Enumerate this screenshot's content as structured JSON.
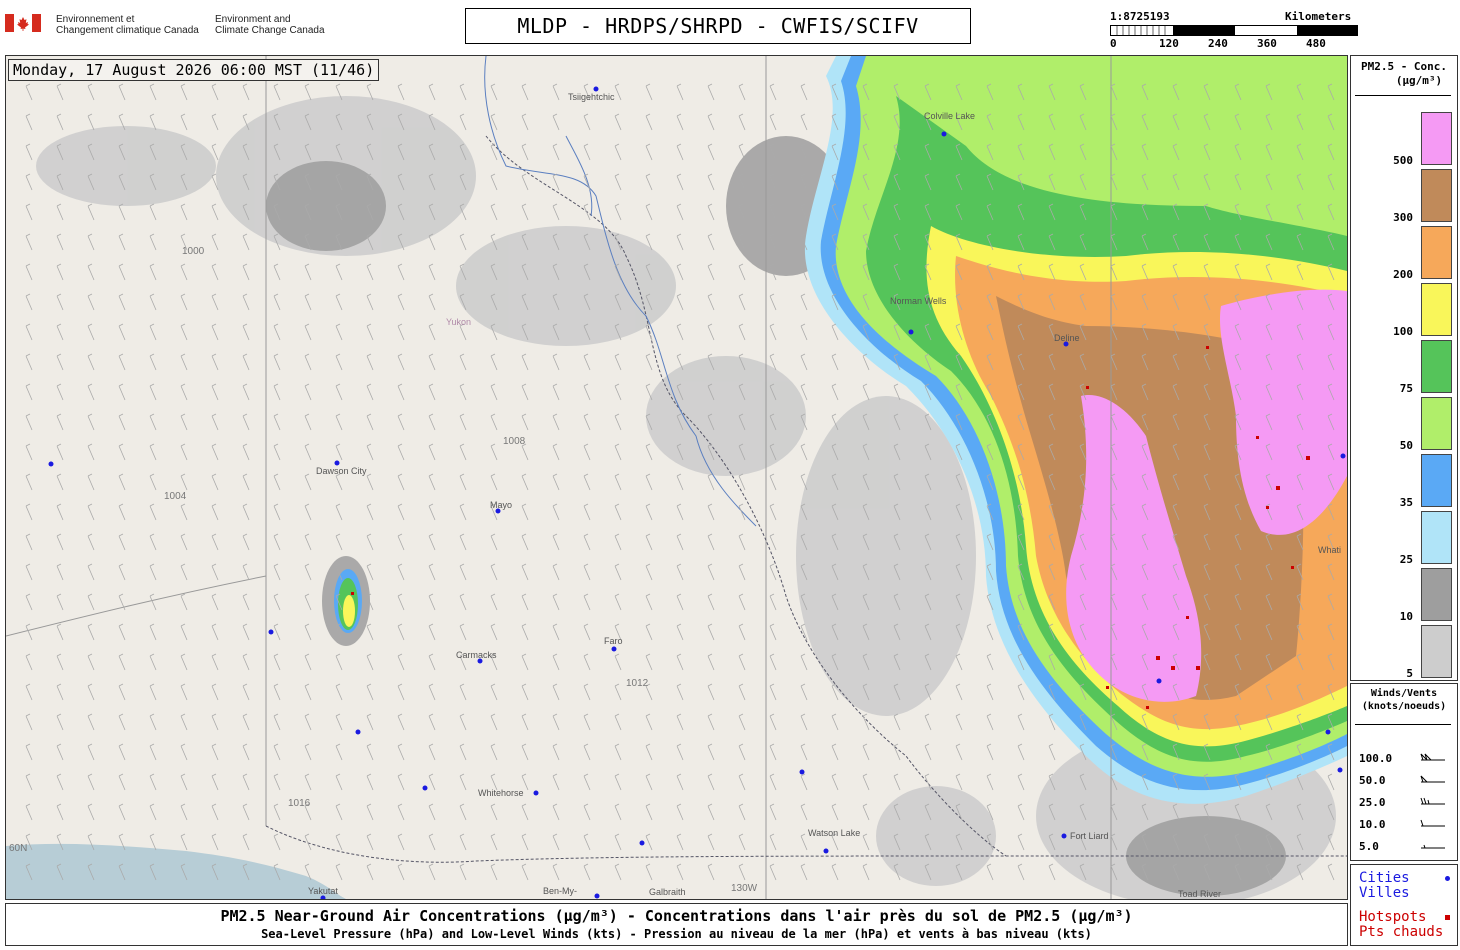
{
  "header": {
    "agency_fr_line1": "Environnement et",
    "agency_fr_line2": "Changement climatique Canada",
    "agency_en_line1": "Environment and",
    "agency_en_line2": "Climate Change Canada",
    "title": "MLDP - HRDPS/SHRPD - CWFIS/SCIFV"
  },
  "scale": {
    "ratio": "1:8725193",
    "unit": "Kilometers",
    "ticks": [
      "0",
      "120",
      "240",
      "360",
      "480"
    ]
  },
  "map": {
    "timestamp": "Monday, 17 August 2026 06:00 MST (11/46)",
    "places": [
      {
        "name": "Tsiigehtchic"
      },
      {
        "name": "Colville Lake"
      },
      {
        "name": "Norman Wells"
      },
      {
        "name": "Deline"
      },
      {
        "name": "Dawson City"
      },
      {
        "name": "Mayo"
      },
      {
        "name": "Carmacks"
      },
      {
        "name": "Faro"
      },
      {
        "name": "Whitehorse"
      },
      {
        "name": "Watson Lake"
      },
      {
        "name": "Fort Liard"
      },
      {
        "name": "Yakutat"
      },
      {
        "name": "Ben-My-"
      },
      {
        "name": "Galbraith"
      },
      {
        "name": "Toad River"
      },
      {
        "name": "Yukon"
      },
      {
        "name": "Whati"
      }
    ],
    "isobars": [
      "1000",
      "1004",
      "1008",
      "1012",
      "1016"
    ],
    "meridian_label": "130W",
    "parallel_label": "60N"
  },
  "legend": {
    "title_line1": "PM2.5 - Conc.",
    "title_line2": "(µg/m³)",
    "levels": [
      {
        "label": "500",
        "color": "#f59af4"
      },
      {
        "label": "300",
        "color": "#c08a5a"
      },
      {
        "label": "200",
        "color": "#f6a85a"
      },
      {
        "label": "100",
        "color": "#f9f65a"
      },
      {
        "label": "75",
        "color": "#55c45a"
      },
      {
        "label": "50",
        "color": "#b0ee6a"
      },
      {
        "label": "35",
        "color": "#5aa9f5"
      },
      {
        "label": "25",
        "color": "#b0e4f8"
      },
      {
        "label": "10",
        "color": "#9e9e9e"
      },
      {
        "label": "5",
        "color": "#cdcdcd"
      }
    ]
  },
  "winds": {
    "title_line1": "Winds/Vents",
    "title_line2": "(knots/noeuds)",
    "values": [
      "100.0",
      "50.0",
      "25.0",
      "10.0",
      "5.0"
    ]
  },
  "cities_legend": {
    "cities_en": "Cities",
    "cities_fr": "Villes",
    "hotspots_en": "Hotspots",
    "hotspots_fr": "Pts chauds",
    "city_color": "#1a1ae0",
    "hotspot_color": "#cc0000"
  },
  "footer": {
    "line1": "PM2.5 Near-Ground Air Concentrations (µg/m³) - Concentrations dans l'air près du sol de PM2.5 (µg/m³)",
    "line2": "Sea-Level Pressure (hPa) and Low-Level Winds (kts) - Pression au niveau de la mer (hPa) et vents à bas niveau (kts)"
  }
}
